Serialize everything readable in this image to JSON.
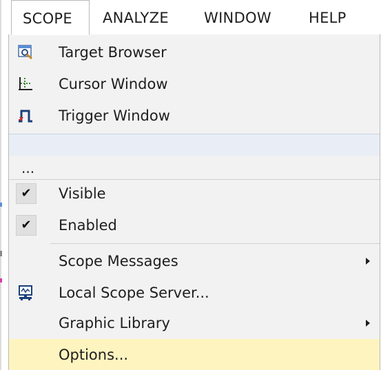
{
  "menubar": {
    "items": [
      {
        "label": "SCOPE",
        "active": true
      },
      {
        "label": "ANALYZE",
        "active": false
      },
      {
        "label": "WINDOW",
        "active": false
      },
      {
        "label": "HELP",
        "active": false
      }
    ]
  },
  "menu": {
    "items": [
      {
        "label": "Target Browser",
        "icon": "target-browser-icon"
      },
      {
        "label": "Cursor Window",
        "icon": "cursor-window-icon"
      },
      {
        "label": "Trigger Window",
        "icon": "trigger-window-icon"
      },
      {
        "label": "..."
      },
      {
        "label": "Visible",
        "checked": true
      },
      {
        "label": "Enabled",
        "checked": true
      },
      {
        "label": "Scope Messages",
        "submenu": true
      },
      {
        "label": "Local Scope Server...",
        "icon": "local-scope-server-icon"
      },
      {
        "label": "Graphic Library",
        "submenu": true
      },
      {
        "label": "Options...",
        "highlighted": true
      }
    ]
  },
  "colors": {
    "highlight": "#fdf4bf",
    "menu_bg": "#f2f2f2",
    "text": "#1e1e1e"
  }
}
